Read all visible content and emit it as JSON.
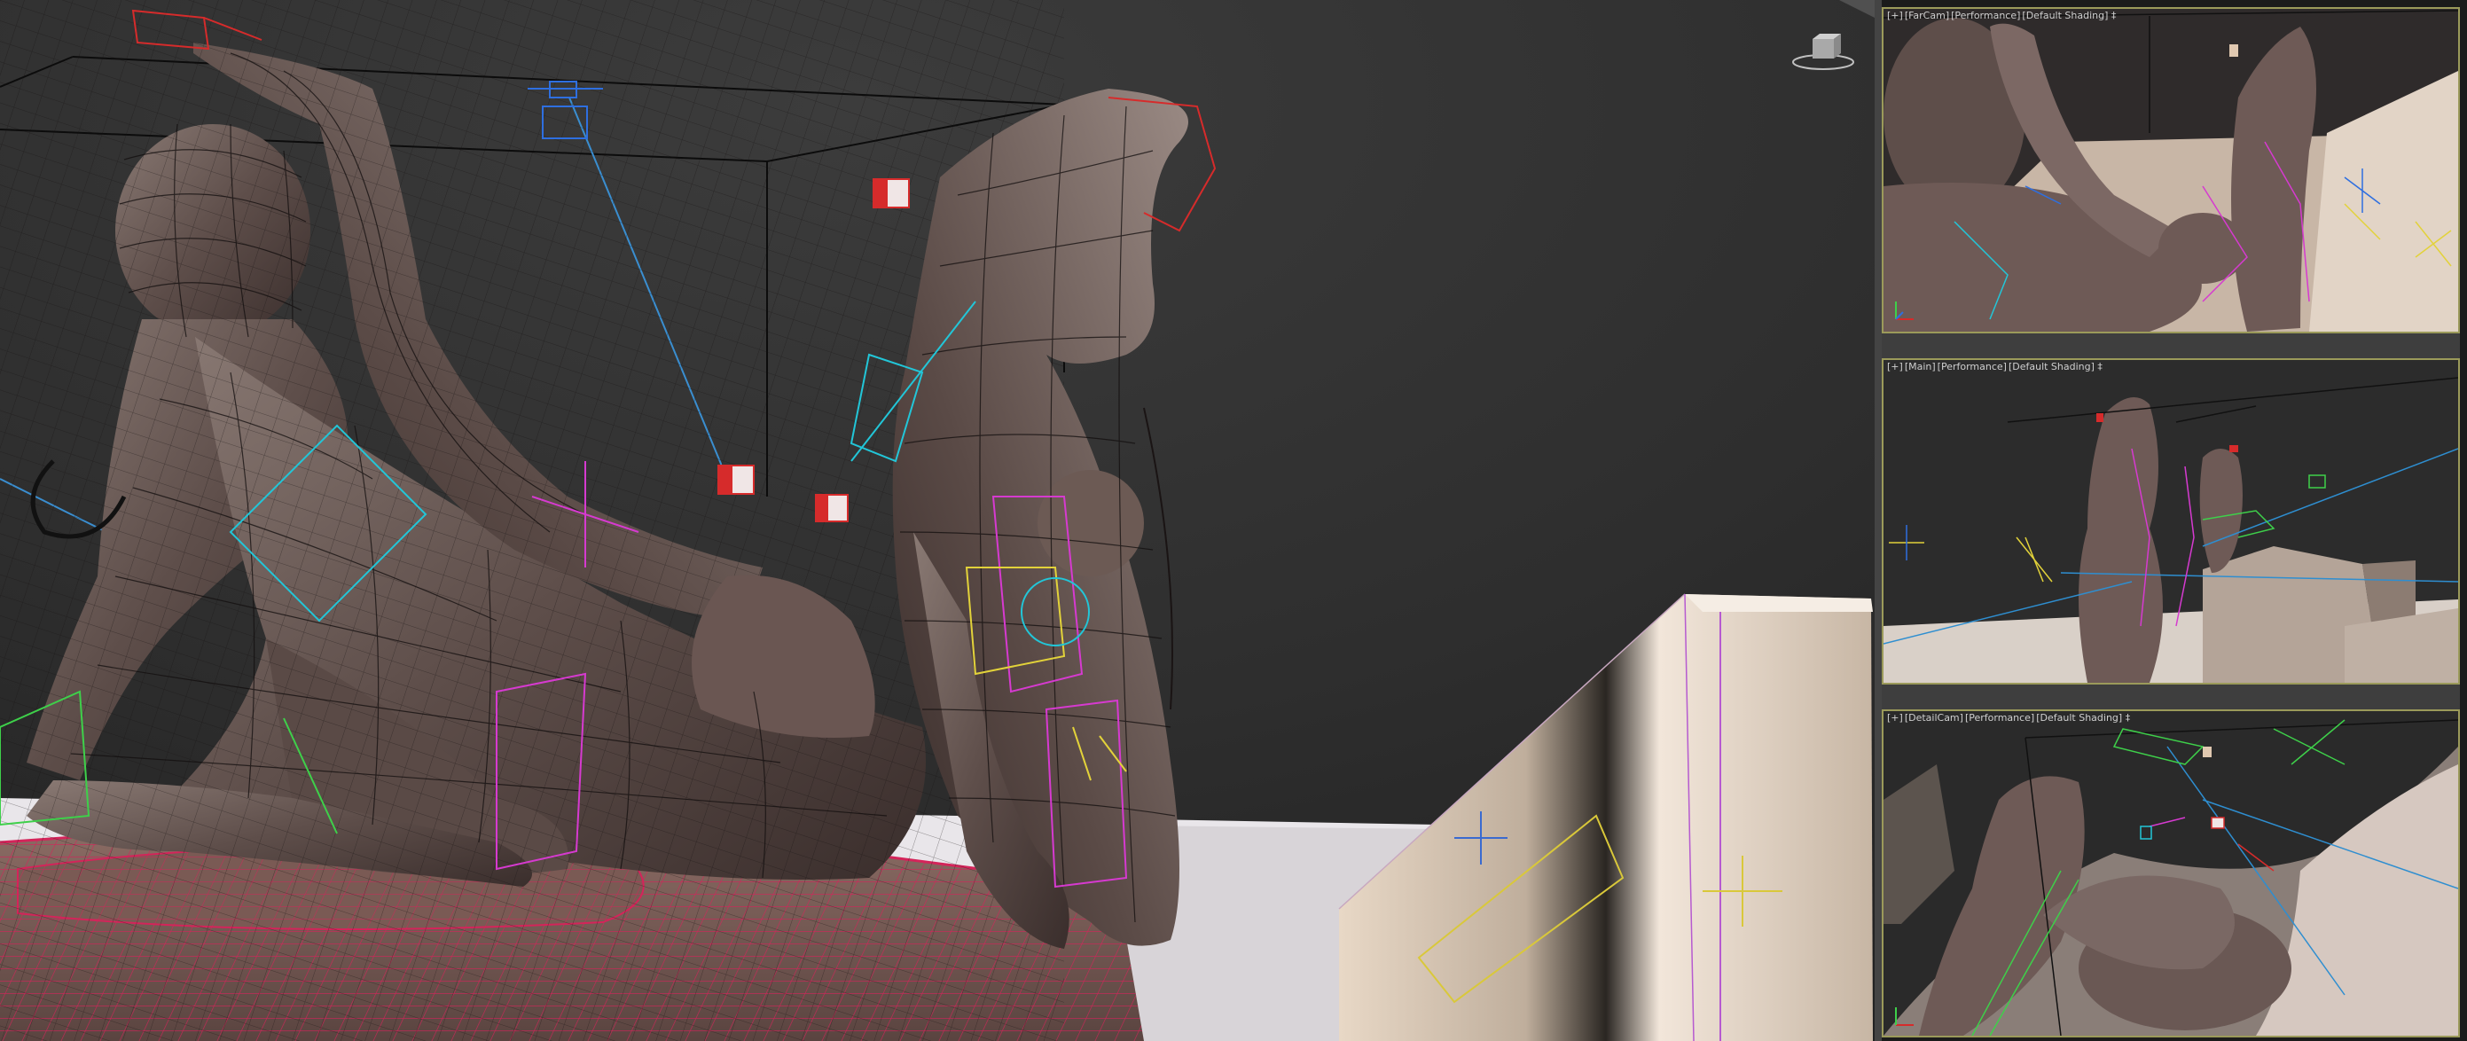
{
  "app": {
    "name": "3D viewport workspace"
  },
  "viewports": {
    "main": {
      "has_label": false
    },
    "top": {
      "menu": "[+]",
      "camera": "[FarCam]",
      "mode": "[Performance]",
      "shading": "[Default Shading]",
      "filter": "‡"
    },
    "mid": {
      "menu": "[+]",
      "camera": "[Main]",
      "mode": "[Performance]",
      "shading": "[Default Shading]",
      "filter": "‡"
    },
    "bot": {
      "menu": "[+]",
      "camera": "[DetailCam]",
      "mode": "[Performance]",
      "shading": "[Default Shading]",
      "filter": "‡"
    }
  },
  "icons": {
    "viewcube": "viewcube-icon",
    "light_helper": "light-helper-icon",
    "camera_helper": "camera-helper-icon"
  },
  "colors": {
    "active_border": "#9b9a5a",
    "wire_skin": "#1a1414",
    "wire_floor": "#d4245a",
    "bone_cyan": "#22c6d8",
    "bone_magenta": "#d63ad0",
    "bone_green": "#3ed04a",
    "bone_yellow": "#e2d23a",
    "light_blue": "#2e6fe0",
    "light_red": "#d62b2b"
  }
}
